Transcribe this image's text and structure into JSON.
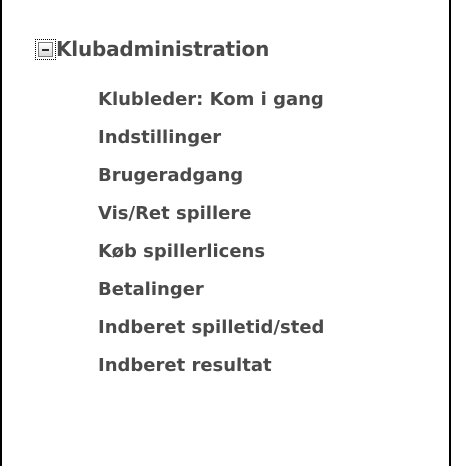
{
  "tree": {
    "root": {
      "label": "Klubadministration",
      "toggle_icon": "minus-box-icon",
      "expanded": true
    },
    "items": [
      {
        "label": "Klubleder: Kom i gang"
      },
      {
        "label": "Indstillinger"
      },
      {
        "label": "Brugeradgang"
      },
      {
        "label": "Vis/Ret spillere"
      },
      {
        "label": "Køb spillerlicens"
      },
      {
        "label": "Betalinger"
      },
      {
        "label": "Indberet spilletid/sted"
      },
      {
        "label": "Indberet resultat"
      }
    ]
  },
  "colors": {
    "text": "#4a4a4a",
    "frame_border": "#000000",
    "background": "#ffffff"
  }
}
